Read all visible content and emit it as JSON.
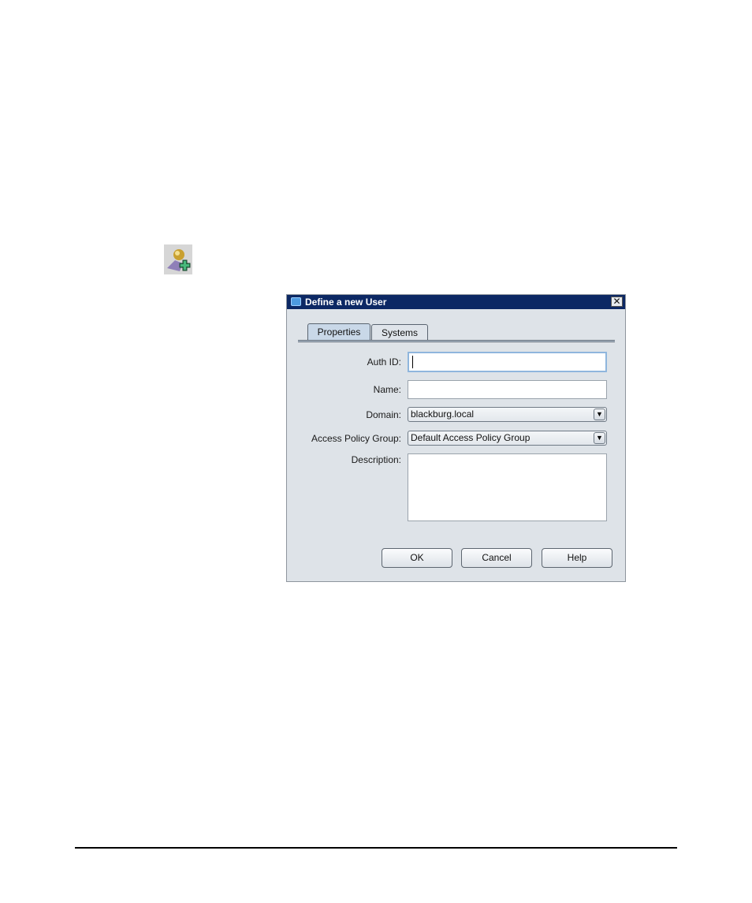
{
  "dialog": {
    "title": "Define a new User",
    "close_symbol": "✕",
    "tabs": [
      {
        "label": "Properties",
        "selected": true
      },
      {
        "label": "Systems",
        "selected": false
      }
    ],
    "fields": {
      "auth_id_label": "Auth ID:",
      "auth_id_value": "",
      "name_label": "Name:",
      "name_value": "",
      "domain_label": "Domain:",
      "domain_value": "blackburg.local",
      "policy_label": "Access Policy Group:",
      "policy_value": "Default Access Policy Group",
      "description_label": "Description:",
      "description_value": ""
    },
    "buttons": {
      "ok": "OK",
      "cancel": "Cancel",
      "help": "Help"
    }
  },
  "icons": {
    "toolbar": "add-user-icon",
    "dropdown": "chevron-down-icon",
    "window": "window-icon"
  },
  "colors": {
    "titlebar": "#0c2864",
    "dialog_bg": "#dee3e8",
    "tab_selected": "#c9d8e8",
    "focus_border": "#8fb6dd"
  }
}
